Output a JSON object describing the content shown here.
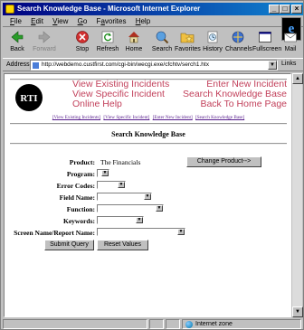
{
  "window": {
    "title": "Search Knowledge Base - Microsoft Internet Explorer",
    "min": "_",
    "max": "□",
    "close": "×"
  },
  "menu": {
    "items": [
      {
        "label": "File",
        "key": "F",
        "rest": "ile"
      },
      {
        "label": "Edit",
        "key": "E",
        "rest": "dit"
      },
      {
        "label": "View",
        "key": "V",
        "rest": "iew"
      },
      {
        "label": "Go",
        "key": "G",
        "rest": "o"
      },
      {
        "label": "Favorites",
        "key": "a",
        "pre": "F",
        "rest": "vorites"
      },
      {
        "label": "Help",
        "key": "H",
        "rest": "elp"
      }
    ]
  },
  "toolbar": {
    "back": "Back",
    "forward": "Forward",
    "stop": "Stop",
    "refresh": "Refresh",
    "home": "Home",
    "search": "Search",
    "favorites": "Favorites",
    "history": "History",
    "channels": "Channels",
    "fullscreen": "Fullscreen",
    "mail": "Mail"
  },
  "address": {
    "label": "Address",
    "url": "http://webdemo.custfirst.com/cgi-bin/wecgi.exe/cfchtv/serch1.htx",
    "links": "Links"
  },
  "banner": {
    "logo_text": "RTI",
    "left_links": [
      "View Existing Incidents",
      "View Specific Incident",
      "Online Help"
    ],
    "right_links": [
      "Enter New Incident",
      "Search Knowledge Base",
      "Back To Home Page"
    ]
  },
  "small_links": [
    "[View Existing Incidents]",
    "[View Specific Incident]",
    "[Enter New Incident]",
    "[Search Knowledge Base]"
  ],
  "page": {
    "heading": "Search Knowledge Base"
  },
  "form": {
    "product_label": "Product:",
    "product_value": "The Financials",
    "change_product": "Change Product-->",
    "program_label": "Program:",
    "error_codes_label": "Error Codes:",
    "field_name_label": "Field Name:",
    "function_label": "Function:",
    "keywords_label": "Keywords:",
    "screen_name_label": "Screen Name/Report Name:",
    "submit": "Submit Query",
    "reset": "Reset Values"
  },
  "status": {
    "zone": "Internet zone"
  },
  "colors": {
    "banner_link": "#c2415b",
    "title_bar": "#000080"
  }
}
